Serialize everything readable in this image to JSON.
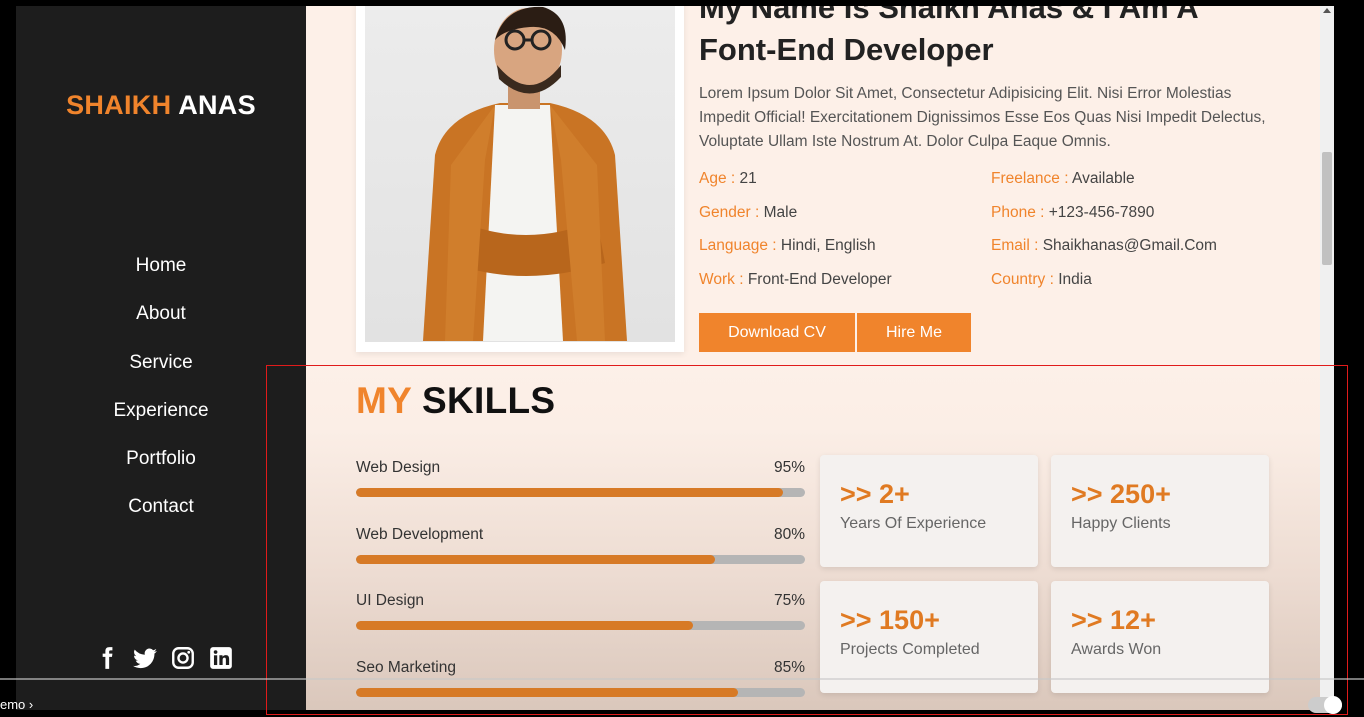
{
  "logo": {
    "first": "SHAIKH",
    "last": "ANAS"
  },
  "nav": [
    "Home",
    "About",
    "Service",
    "Experience",
    "Portfolio",
    "Contact"
  ],
  "socials": [
    "facebook-icon",
    "twitter-icon",
    "instagram-icon",
    "linkedin-icon"
  ],
  "about": {
    "headline_line1": "My Name Is Shaikh Anas & I Am A",
    "headline_line2": "Font-End Developer",
    "description": "Lorem Ipsum Dolor Sit Amet, Consectetur Adipisicing Elit. Nisi Error Molestias Impedit Official! Exercitationem Dignissimos Esse Eos Quas Nisi Impedit Delectus, Voluptate Ullam Iste Nostrum At. Dolor Culpa Eaque Omnis.",
    "info": [
      {
        "key": "Age",
        "value": "21"
      },
      {
        "key": "Freelance",
        "value": "Available"
      },
      {
        "key": "Gender",
        "value": "Male"
      },
      {
        "key": "Phone",
        "value": "+123-456-7890"
      },
      {
        "key": "Language",
        "value": "Hindi, English"
      },
      {
        "key": "Email",
        "value": "Shaikhanas@Gmail.Com"
      },
      {
        "key": "Work",
        "value": "Front-End Developer"
      },
      {
        "key": "Country",
        "value": "India"
      }
    ],
    "buttons": {
      "download": "Download CV",
      "hire": "Hire Me"
    }
  },
  "skills": {
    "title_accent": "MY",
    "title_rest": "SKILLS",
    "items": [
      {
        "name": "Web Design",
        "percent": "95%",
        "value": 95
      },
      {
        "name": "Web Development",
        "percent": "80%",
        "value": 80
      },
      {
        "name": "UI Design",
        "percent": "75%",
        "value": 75
      },
      {
        "name": "Seo Marketing",
        "percent": "85%",
        "value": 85
      }
    ],
    "stats": [
      {
        "num": ">> 2+",
        "caption": "Years Of Experience"
      },
      {
        "num": ">> 250+",
        "caption": "Happy Clients"
      },
      {
        "num": ">> 150+",
        "caption": "Projects Completed"
      },
      {
        "num": ">> 12+",
        "caption": "Awards Won"
      }
    ]
  },
  "player": {
    "label": "emo"
  },
  "colors": {
    "accent": "#f0842c",
    "sidebar": "#1d1d1d",
    "page": "#fdf0e8"
  }
}
